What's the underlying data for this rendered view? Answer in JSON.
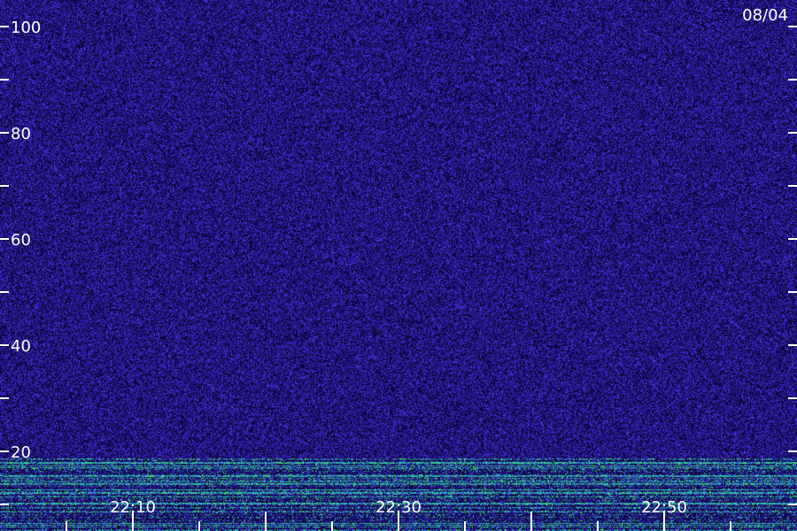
{
  "chart_data": {
    "type": "heatmap",
    "title": "",
    "date_label": "08/04",
    "xlabel": "",
    "ylabel": "",
    "x_ticks_major": [
      "22:10",
      "22:30",
      "22:50"
    ],
    "x_ticks_minor_count": 12,
    "y_ticks_major": [
      100,
      80,
      60,
      40,
      20
    ],
    "y_ticks_minor": [
      90,
      70,
      50,
      30,
      10
    ],
    "y_range": [
      10,
      102
    ],
    "grid": false,
    "colors": {
      "background": "#140a5a",
      "noise_dark": "#0a0530",
      "noise_mid": "#2a1aa0",
      "noise_bright": "#4a35e0",
      "signal_teal": "#1fbfc0",
      "signal_green": "#3fe060",
      "tick": "#ffffff"
    }
  }
}
